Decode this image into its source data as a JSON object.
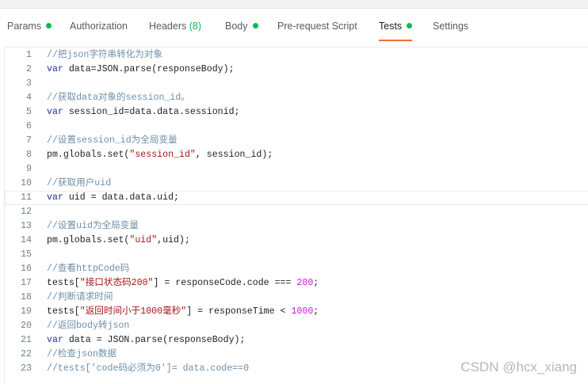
{
  "tabs": [
    {
      "label": "Params",
      "dot": true
    },
    {
      "label": "Authorization"
    },
    {
      "label": "Headers",
      "count": "(8)"
    },
    {
      "label": "Body",
      "dot": true
    },
    {
      "label": "Pre-request Script"
    },
    {
      "label": "Tests",
      "dot": true,
      "active": true
    },
    {
      "label": "Settings"
    }
  ],
  "editor": {
    "current_line": 11,
    "lines": [
      [
        [
          "c",
          "//把json字符串转化为对象"
        ]
      ],
      [
        [
          "k",
          "var"
        ],
        [
          "p",
          " data=JSON.parse(responseBody);"
        ]
      ],
      [],
      [
        [
          "c",
          "//获取data对象的session_id。"
        ]
      ],
      [
        [
          "k",
          "var"
        ],
        [
          "p",
          " session_id=data.data.sessionid;"
        ]
      ],
      [],
      [
        [
          "c",
          "//设置session_id为全局变量"
        ]
      ],
      [
        [
          "p",
          "pm.globals.set("
        ],
        [
          "s",
          "\"session_id\""
        ],
        [
          "p",
          ", session_id);"
        ]
      ],
      [],
      [
        [
          "c",
          "//获取用户uid"
        ]
      ],
      [
        [
          "k",
          "var"
        ],
        [
          "p",
          " uid = data.data.uid;"
        ]
      ],
      [],
      [
        [
          "c",
          "//设置uid为全局变量"
        ]
      ],
      [
        [
          "p",
          "pm.globals.set("
        ],
        [
          "s",
          "\"uid\""
        ],
        [
          "p",
          ",uid);"
        ]
      ],
      [],
      [
        [
          "c",
          "//查看httpCode码"
        ]
      ],
      [
        [
          "p",
          "tests["
        ],
        [
          "s",
          "\"接口状态码200\""
        ],
        [
          "p",
          "] = responseCode.code === "
        ],
        [
          "n",
          "200"
        ],
        [
          "p",
          ";"
        ]
      ],
      [
        [
          "c",
          "//判断请求时间"
        ]
      ],
      [
        [
          "p",
          "tests["
        ],
        [
          "s",
          "\"返回时间小于1000毫秒\""
        ],
        [
          "p",
          "] = responseTime < "
        ],
        [
          "n",
          "1000"
        ],
        [
          "p",
          ";"
        ]
      ],
      [
        [
          "c",
          "//返回body转json"
        ]
      ],
      [
        [
          "k",
          "var"
        ],
        [
          "p",
          " data = JSON.parse(responseBody);"
        ]
      ],
      [
        [
          "c",
          "//检查json数据"
        ]
      ],
      [
        [
          "c",
          "//tests['code码必须为0']= data.code==0"
        ]
      ]
    ]
  },
  "watermark": "CSDN @hcx_xiang",
  "colors": {
    "accent": "#f26b3a",
    "status_dot": "#0cbb52"
  }
}
